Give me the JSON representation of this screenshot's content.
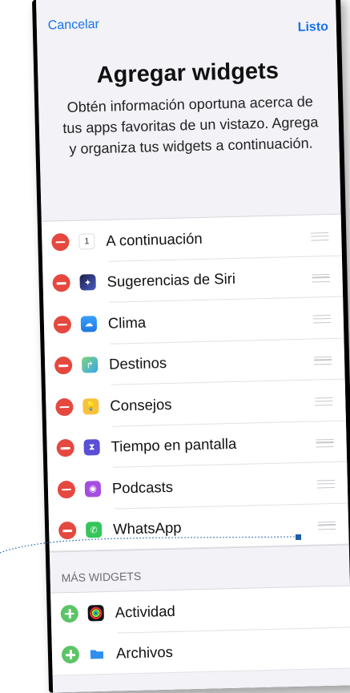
{
  "nav": {
    "cancel_label": "Cancelar",
    "done_label": "Listo"
  },
  "header": {
    "title": "Agregar widgets",
    "subtitle": "Obtén información oportuna acerca de tus apps favoritas de un vistazo. Agrega y organiza tus widgets a continuación."
  },
  "active_widgets": [
    {
      "label": "A continuación",
      "icon": "calendar-icon",
      "icon_text": "1",
      "color": "#ffffff"
    },
    {
      "label": "Sugerencias de Siri",
      "icon": "siri-icon",
      "color": "#2b2f6b"
    },
    {
      "label": "Clima",
      "icon": "weather-icon",
      "color": "#2f8ff0"
    },
    {
      "label": "Destinos",
      "icon": "maps-icon",
      "color": "#6cc36a"
    },
    {
      "label": "Consejos",
      "icon": "tips-icon",
      "color": "#f7c23b"
    },
    {
      "label": "Tiempo en pantalla",
      "icon": "screen-time-icon",
      "color": "#5a4fd6"
    },
    {
      "label": "Podcasts",
      "icon": "podcasts-icon",
      "color": "#a64ee0"
    },
    {
      "label": "WhatsApp",
      "icon": "whatsapp-icon",
      "color": "#35c55a"
    }
  ],
  "more_widgets": {
    "header": "MÁS WIDGETS",
    "items": [
      {
        "label": "Actividad",
        "icon": "activity-icon",
        "color": "#111111"
      },
      {
        "label": "Archivos",
        "icon": "files-icon",
        "color": "#2f8ff0"
      }
    ]
  }
}
